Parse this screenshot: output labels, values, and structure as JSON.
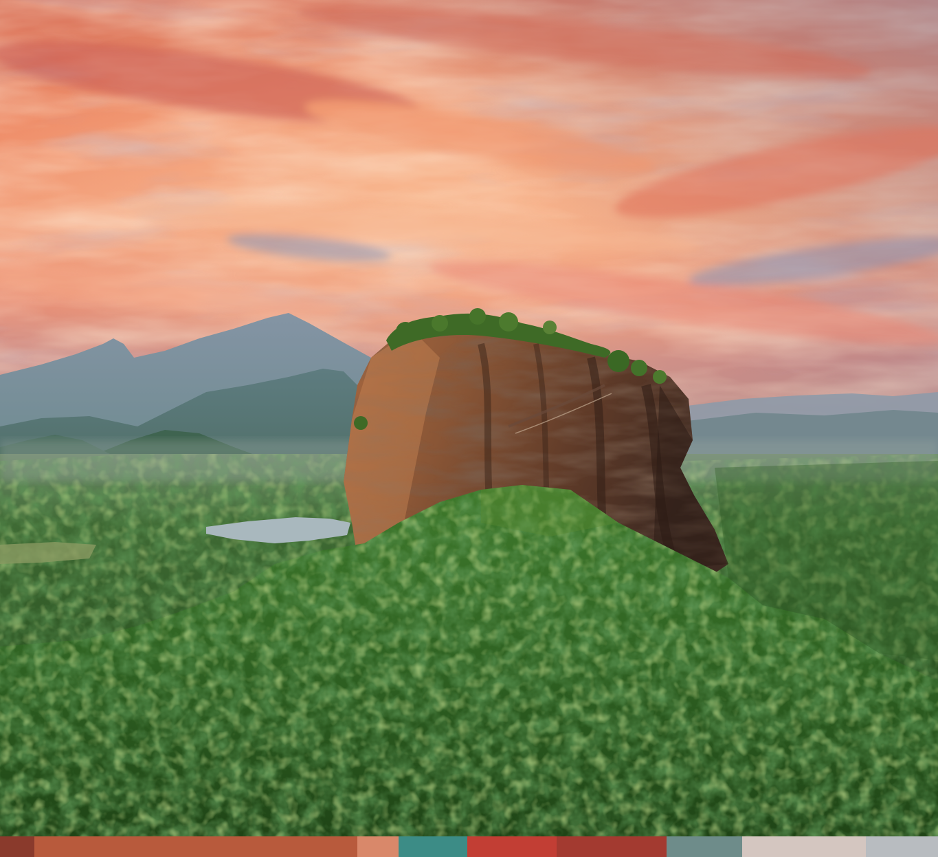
{
  "scene": {
    "subject": "rock-fortress",
    "sky_colors": [
      "#e9876a",
      "#f3a880",
      "#c7686a",
      "#7c8aa4"
    ],
    "rock_colors": [
      "#7a4a30",
      "#a86a44",
      "#4a2c1e"
    ],
    "forest_colors": [
      "#2f5a22",
      "#3f7a2e",
      "#587f3a",
      "#1f3d18"
    ],
    "mountain_colors": [
      "#7b8fa0",
      "#5f7a7e",
      "#4c6b5a"
    ],
    "water_color": "#a9b8be"
  },
  "strip": {
    "segment_colors": [
      "#8a3a2c",
      "#b85a3c",
      "#d9886a",
      "#3c8c86",
      "#c23e34",
      "#a33a30",
      "#6e8c8a",
      "#d4c6c0",
      "#b8bcc0"
    ]
  }
}
